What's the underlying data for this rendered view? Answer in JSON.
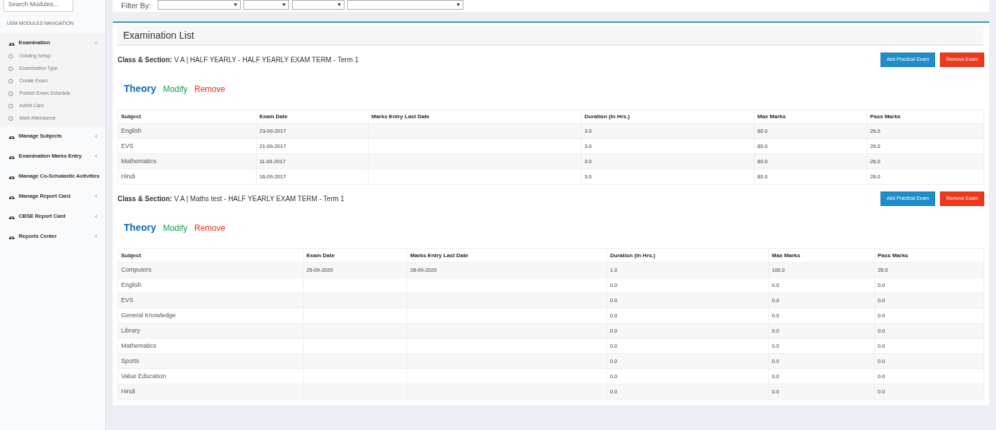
{
  "sidebar": {
    "search": {
      "placeholder": "Search Modules..."
    },
    "heading": "USM MODULES NAVIGATION",
    "items": [
      {
        "label": "Examination",
        "expanded": true,
        "children": [
          {
            "label": "Grading Setup"
          },
          {
            "label": "Examination Type"
          },
          {
            "label": "Create Exam"
          },
          {
            "label": "Publish Exam Schedule"
          },
          {
            "label": "Admit Card"
          },
          {
            "label": "Mark Attendance"
          }
        ]
      },
      {
        "label": "Manage Subjects",
        "expanded": false
      },
      {
        "label": "Examination Marks Entry",
        "expanded": false
      },
      {
        "label": "Manage Co-Scholastic Activities"
      },
      {
        "label": "Manage Report Card",
        "expanded": false
      },
      {
        "label": "CBSE Report Card",
        "expanded": false
      },
      {
        "label": "Reports Center",
        "expanded": false
      }
    ]
  },
  "filter": {
    "label": "Filter By:"
  },
  "panel": {
    "title": "Examination List",
    "exams": [
      {
        "label": "Class & Section:",
        "value": "V A | HALF YEARLY - HALF YEARLY EXAM TERM - Term 1",
        "buttons": [
          "Add Practical Exam",
          "Remove Exam"
        ],
        "type": "Theory",
        "actions": [
          "Modify",
          "Remove"
        ],
        "columns": [
          "Subject",
          "Exam Date",
          "Marks Entry Last Date",
          "Duration (In Hrs.)",
          "Max Marks",
          "Pass Marks"
        ],
        "rows": [
          [
            "English",
            "23-09-2017",
            "",
            "3.0",
            "80.0",
            "26.0"
          ],
          [
            "EVS",
            "21-09-2017",
            "",
            "3.0",
            "80.0",
            "26.0"
          ],
          [
            "Mathematics",
            "11-09-2017",
            "",
            "3.0",
            "80.0",
            "26.0"
          ],
          [
            "Hindi",
            "16-09-2017",
            "",
            "3.0",
            "80.0",
            "26.0"
          ]
        ]
      },
      {
        "label": "Class & Section:",
        "value": "V A | Maths test - HALF YEARLY EXAM TERM - Term 1",
        "buttons": [
          "Add Practical Exam",
          "Remove Exam"
        ],
        "type": "Theory",
        "actions": [
          "Modify",
          "Remove"
        ],
        "columns": [
          "Subject",
          "Exam Date",
          "Marks Entry Last Date",
          "Duration (In Hrs.)",
          "Max Marks",
          "Pass Marks"
        ],
        "rows": [
          [
            "Computers",
            "25-09-2020",
            "28-09-2020",
            "1.0",
            "100.0",
            "35.0"
          ],
          [
            "English",
            "",
            "",
            "0.0",
            "0.0",
            "0.0"
          ],
          [
            "EVS",
            "",
            "",
            "0.0",
            "0.0",
            "0.0"
          ],
          [
            "General Knowledge",
            "",
            "",
            "0.0",
            "0.0",
            "0.0"
          ],
          [
            "Library",
            "",
            "",
            "0.0",
            "0.0",
            "0.0"
          ],
          [
            "Mathematics",
            "",
            "",
            "0.0",
            "0.0",
            "0.0"
          ],
          [
            "Sports",
            "",
            "",
            "0.0",
            "0.0",
            "0.0"
          ],
          [
            "Value Education",
            "",
            "",
            "0.0",
            "0.0",
            "0.0"
          ],
          [
            "Hindi",
            "",
            "",
            "0.0",
            "0.0",
            "0.0"
          ]
        ]
      }
    ]
  }
}
